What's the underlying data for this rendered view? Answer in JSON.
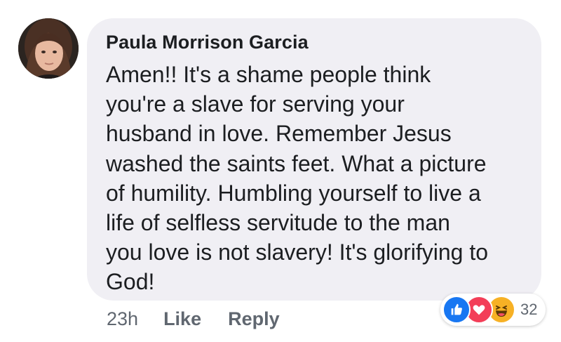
{
  "comment": {
    "author": "Paula Morrison Garcia",
    "text": "Amen!! It's a shame people think\nyou're a slave for serving your\nhusband in love. Remember Jesus\nwashed the saints feet. What a picture\nof humility. Humbling yourself to live a\nlife of selfless servitude to the man\nyou love is not slavery! It's glorifying to\nGod!",
    "bubble_color": "#f0eff4"
  },
  "actions": {
    "time": "23h",
    "like_label": "Like",
    "reply_label": "Reply"
  },
  "reactions": {
    "icons": [
      "like-icon",
      "love-icon",
      "haha-icon"
    ],
    "colors": {
      "like": "#1877f2",
      "love": "#f33e58",
      "haha": "#f7b125"
    },
    "count": "32"
  }
}
